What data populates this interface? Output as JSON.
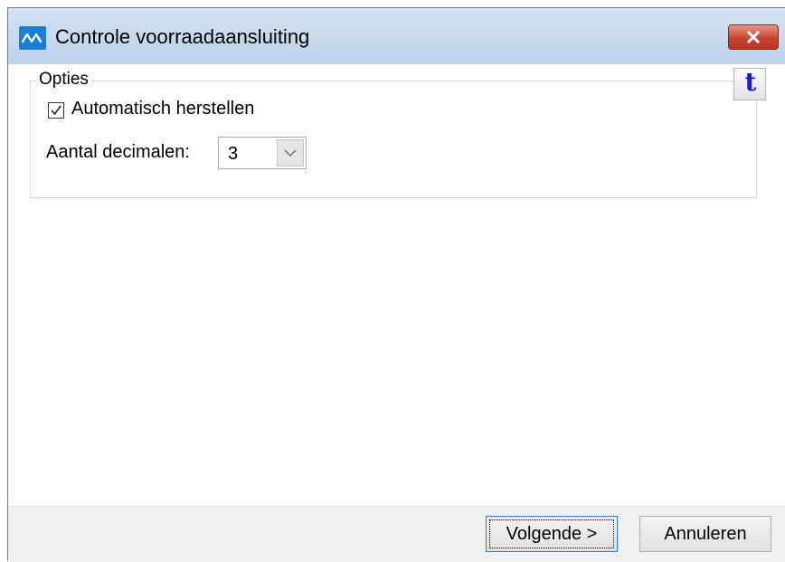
{
  "window": {
    "title": "Controle voorraadaansluiting",
    "app_icon": "av-logo-icon",
    "close_icon": "close-x-icon"
  },
  "options": {
    "legend": "Opties",
    "auto_repair": {
      "label": "Automatisch herstellen",
      "checked": true
    },
    "decimals": {
      "label": "Aantal decimalen:",
      "value": "3"
    },
    "help_icon": {
      "glyph": "t",
      "name": "t-help-icon"
    }
  },
  "buttons": {
    "next": "Volgende >",
    "cancel": "Annuleren"
  },
  "colors": {
    "titlebar": "#c9dbef",
    "close_button": "#c7432f",
    "accent_blue": "#1a7ed4",
    "help_glyph": "#1b1bd6"
  }
}
